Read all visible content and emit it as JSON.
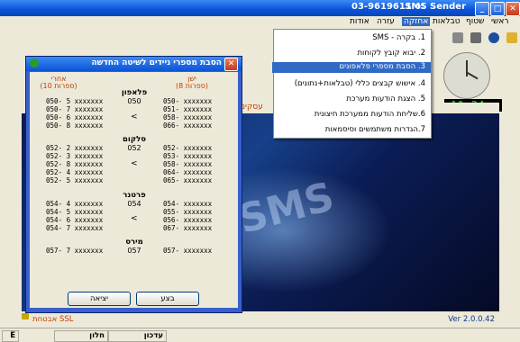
{
  "window": {
    "title": "SMS Sender",
    "phone_prefix": "ס:",
    "phone": "03-9619611"
  },
  "menu": {
    "items": [
      "ראשי",
      "שטוף",
      "טבלאות",
      "אחזקה",
      "עזרה",
      "אודות"
    ],
    "active_index": 3
  },
  "dropdown": {
    "items": [
      "1. בקרה - SMS",
      "2. יבוא קובץ לקוחות",
      "3. הסבת מספרי פלאפונים",
      "4. אישוש קבצים כללי (טבלאות+נתונים)",
      "5. הצגת הודעות מערכת",
      "6.שליחת הודעות ממערכת חיצונית",
      "7.הגדרות משתמשים וסיסמאות"
    ],
    "selected_index": 2
  },
  "clock": {
    "time": "10:24",
    "ampm": "AM"
  },
  "main": {
    "header_label": "עסקים",
    "logo_text": "SMS"
  },
  "version": "Ver 2.0.0.42",
  "ssl_label": "אבטחת SSL",
  "statusbar": {
    "cells": [
      "עדכון",
      "חלון",
      "E"
    ]
  },
  "dialog": {
    "title": "הסבת מספרי ניידים לשיטה החדשה",
    "col_right_header": "ישן",
    "col_right_sub": "(8 ספרות)",
    "col_left_header": "אחרי",
    "col_left_sub": "(10 ספרות)",
    "groups": [
      {
        "name": "פלאפון",
        "code": "050",
        "old": [
          "050- xxxxxxx",
          "051- xxxxxxx",
          "058- xxxxxxx",
          "066- xxxxxxx"
        ],
        "new": [
          "050- 5 xxxxxxx",
          "050- 7 xxxxxxx",
          "050- 6 xxxxxxx",
          "050- 8 xxxxxxx"
        ]
      },
      {
        "name": "סלקום",
        "code": "052",
        "old": [
          "052- xxxxxxx",
          "053- xxxxxxx",
          "058- xxxxxxx",
          "064- xxxxxxx",
          "065- xxxxxxx"
        ],
        "new": [
          "052- 2 xxxxxxx",
          "052- 3 xxxxxxx",
          "052- 8 xxxxxxx",
          "052- 4 xxxxxxx",
          "052- 5 xxxxxxx"
        ]
      },
      {
        "name": "פרטנר",
        "code": "054",
        "old": [
          "054- xxxxxxx",
          "055- xxxxxxx",
          "056- xxxxxxx",
          "067- xxxxxxx"
        ],
        "new": [
          "054- 4 xxxxxxx",
          "054- 5 xxxxxxx",
          "054- 6 xxxxxxx",
          "054- 7 xxxxxxx"
        ]
      },
      {
        "name": "מירס",
        "code": "057",
        "old": [
          "057- xxxxxxx"
        ],
        "new": [
          "057- 7 xxxxxxx"
        ]
      }
    ],
    "arrow": "<",
    "buttons": {
      "execute": "בצע",
      "exit": "יציאה"
    }
  }
}
